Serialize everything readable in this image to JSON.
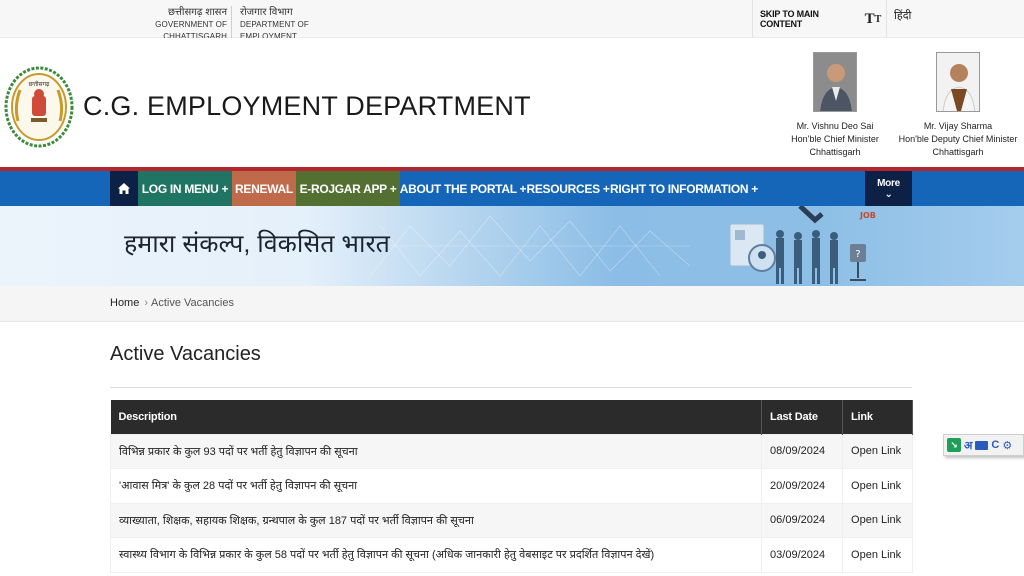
{
  "topbar": {
    "gov_hindi": "छत्तीसगढ़ शासन",
    "gov_english": "GOVERNMENT OF CHHATTISGARH",
    "dept_hindi": "रोजगार विभाग",
    "dept_english": "DEPARTMENT OF EMPLOYMENT",
    "skip_link": "SKIP TO MAIN CONTENT",
    "text_size_big": "T",
    "text_size_small": "T",
    "language_link": "हिंदी"
  },
  "header": {
    "site_title": "C.G. EMPLOYMENT DEPARTMENT",
    "emblem_text": "छत्तीसगढ़ शासन",
    "leaders": [
      {
        "name": "Mr. Vishnu Deo Sai",
        "role": "Hon'ble Chief Minister",
        "state": "Chhattisgarh"
      },
      {
        "name": "Mr. Vijay Sharma",
        "role": "Hon'ble Deputy Chief Minister",
        "state": "Chhattisgarh"
      }
    ]
  },
  "nav": {
    "home_icon": "home-icon",
    "items": [
      {
        "label": "LOG IN MENU +"
      },
      {
        "label": "RENEWAL"
      },
      {
        "label": "E-ROJGAR APP +"
      },
      {
        "label": "ABOUT THE PORTAL +"
      },
      {
        "label": "RESOURCES +"
      },
      {
        "label": "RIGHT TO INFORMATION +"
      }
    ],
    "more_label": "More",
    "more_icon": "⌄"
  },
  "banner": {
    "tagline": "हमारा संकल्प, विकसित भारत"
  },
  "breadcrumb": {
    "home": "Home",
    "separator": "›",
    "current": "Active Vacancies"
  },
  "page": {
    "title": "Active Vacancies"
  },
  "table": {
    "headers": {
      "description": "Description",
      "last_date": "Last Date",
      "link": "Link"
    },
    "rows": [
      {
        "description": "विभिन्न प्रकार के कुल 93 पदों पर भर्ती हेतु विज्ञापन की सूचना",
        "last_date": "08/09/2024",
        "link": "Open Link"
      },
      {
        "description": "'आवास मित्र' के कुल 28 पदों पर भर्ती हेतु विज्ञापन की सूचना",
        "last_date": "20/09/2024",
        "link": "Open Link"
      },
      {
        "description": "व्याख्याता, शिक्षक, सहायक शिक्षक, ग्रन्थपाल के कुल 187 पदों पर भर्ती विज्ञापन की सूचना",
        "last_date": "06/09/2024",
        "link": "Open Link"
      },
      {
        "description": "स्वास्थ्य विभाग के विभिन्न प्रकार के कुल 58 पदों पर भर्ती हेतु विज्ञापन की सूचना (अधिक जानकारी हेतु वेबसाइट पर प्रदर्शित विज्ञापन देखें)",
        "last_date": "03/09/2024",
        "link": "Open Link"
      }
    ]
  },
  "ime_toolbar": {
    "lang_char": "अ",
    "c_label": "C"
  },
  "colors": {
    "nav_blue": "#1565b8",
    "nav_dark": "#0d2146",
    "login_green": "#1f7463",
    "renewal_orange": "#c06a4c",
    "erojgar_olive": "#536f32",
    "accent_red": "#b3262b",
    "table_header": "#2b2b2b"
  }
}
